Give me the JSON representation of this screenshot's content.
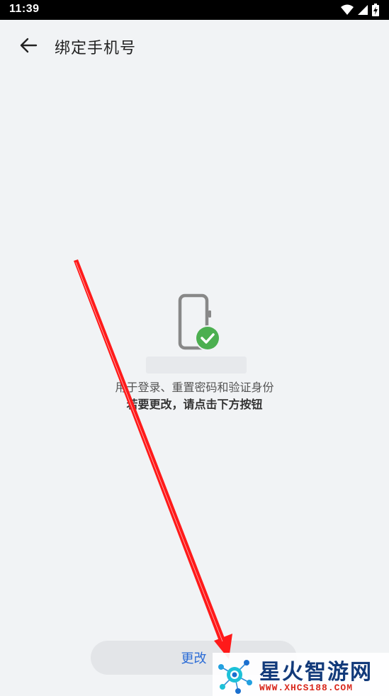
{
  "status_bar": {
    "time": "11:39",
    "icons": [
      "wifi-icon",
      "signal-icon",
      "battery-charging-icon"
    ]
  },
  "header": {
    "back_icon": "arrow-left-icon",
    "title": "绑定手机号"
  },
  "main": {
    "illustration_icon": "phone-check-icon",
    "description_line1": "用于登录、重置密码和验证身份",
    "description_line2": "若要更改，请点击下方按钮"
  },
  "footer": {
    "change_button_label": "更改"
  },
  "watermark": {
    "brand": "星火智游网",
    "url": "WWW.XHCS188.COM"
  },
  "colors": {
    "background": "#f1f3f5",
    "accent": "#2a6bd6",
    "success": "#4caf50",
    "annotation": "#ff0000"
  }
}
